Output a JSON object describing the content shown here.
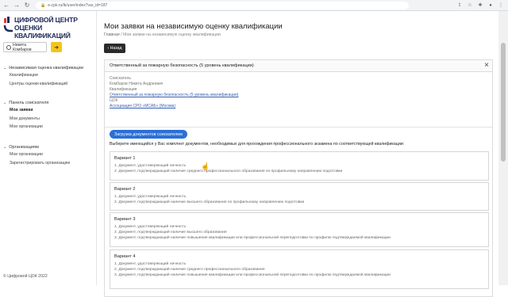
{
  "browser": {
    "url": "e-cpk.ru/lk/user/index?var_id=187"
  },
  "sidebar": {
    "logo_line1": "ЦИФРОВОЙ ЦЕНТР",
    "logo_line2": "ОЦЕНКИ КВАЛИФИКАЦИЙ",
    "user_name": "Никита Комбаров",
    "sections": [
      {
        "title": "Независимая оценка квалификации",
        "items": [
          "Квалификации",
          "Центры оценки квалификаций"
        ]
      },
      {
        "title": "Панель соискателя",
        "items": [
          "Мои заявки",
          "Мои документы",
          "Мои организации"
        ]
      },
      {
        "title": "Организациям",
        "items": [
          "Мои организации",
          "Зарегистрировать организацию"
        ]
      }
    ],
    "footer": "© Цифровой ЦОК 2022"
  },
  "main": {
    "title": "Мои заявки на независимую оценку квалификации",
    "breadcrumb_home": "Главная",
    "breadcrumb_sep": "/",
    "breadcrumb_current": "Мои заявки на независимую оценку квалификации",
    "back_label": "Назад",
    "panel_title": "Ответственный за пожарную безопасность (5 уровень квалификации)",
    "info": {
      "applicant_label": "Соискатель",
      "applicant_value": "Комбаров Никита Андреевич",
      "qualification_label": "Квалификация",
      "qualification_value": "Ответственный за пожарную безопасность (5 уровень квалификации)",
      "center_label": "ЦОК",
      "center_value": "Ассоциация СРО «МСАБ» (Москва)"
    },
    "upload_badge": "Загрузка документов соискателем",
    "instruction": "Выберите имеющийся у Вас комплект документов, необходимых для прохождения профессионального экзамена по соответствующей квалификации:",
    "variants": [
      {
        "title": "Вариант 1",
        "lines": [
          "1. Документ, удостоверяющий личность",
          "2. Документ, подтверждающий наличие среднего профессионального образования по профильному направлению подготовки"
        ]
      },
      {
        "title": "Вариант 2",
        "lines": [
          "1. Документ, удостоверяющий личность",
          "2. Документ, подтверждающий наличие высшего образования по профильному направлению подготовки"
        ]
      },
      {
        "title": "Вариант 3",
        "lines": [
          "1. Документ, удостоверяющий личность",
          "2. Документ, подтверждающий наличие высшего образования",
          "3. Документ, подтверждающий наличие повышения квалификации или профессиональной переподготовки по профилю подтверждаемой квалификации"
        ]
      },
      {
        "title": "Вариант 4",
        "lines": [
          "1. Документ, удостоверяющий личность",
          "2. Документ, подтверждающий наличие среднего профессионального образования",
          "3. Документ, подтверждающий наличие повышения квалификации или профессиональной переподготовки по профилю подтверждаемой квалификации"
        ]
      }
    ]
  },
  "colors": {
    "accent": "#2a6fd6",
    "logout": "#f5c518",
    "back_button": "#2b2b2b",
    "logo": "#1e2a5a"
  }
}
